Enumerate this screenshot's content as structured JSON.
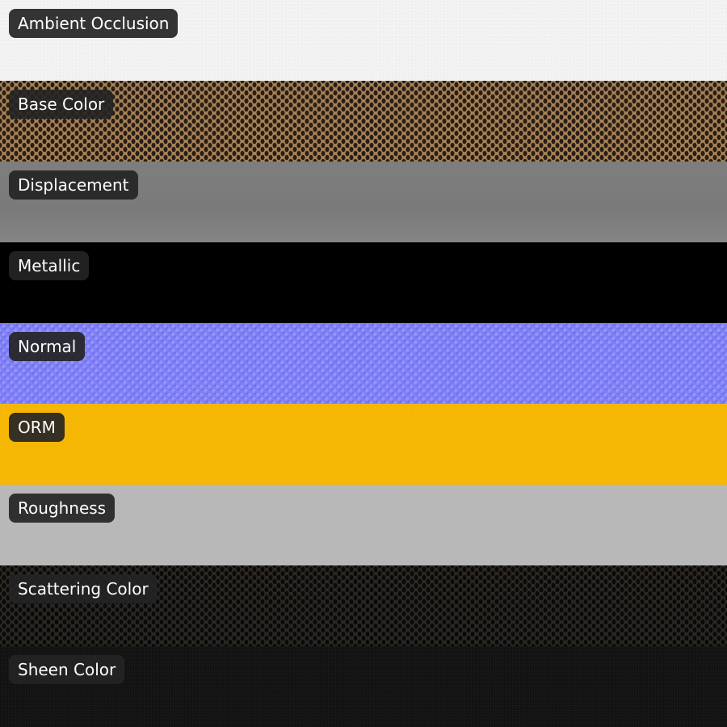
{
  "maps": [
    {
      "label": "Ambient Occlusion",
      "swatch_color": "#f3f3f3"
    },
    {
      "label": "Base Color",
      "swatch_color": "#a7835a"
    },
    {
      "label": "Displacement",
      "swatch_color": "#7e7e7e"
    },
    {
      "label": "Metallic",
      "swatch_color": "#000000"
    },
    {
      "label": "Normal",
      "swatch_color": "#7f7ff7"
    },
    {
      "label": "ORM",
      "swatch_color": "#f6b704"
    },
    {
      "label": "Roughness",
      "swatch_color": "#b8b8b8"
    },
    {
      "label": "Scattering Color",
      "swatch_color": "#2c2925"
    },
    {
      "label": "Sheen Color",
      "swatch_color": "#111111"
    }
  ],
  "label_style": {
    "background": "#242424",
    "text_color": "#ffffff"
  }
}
